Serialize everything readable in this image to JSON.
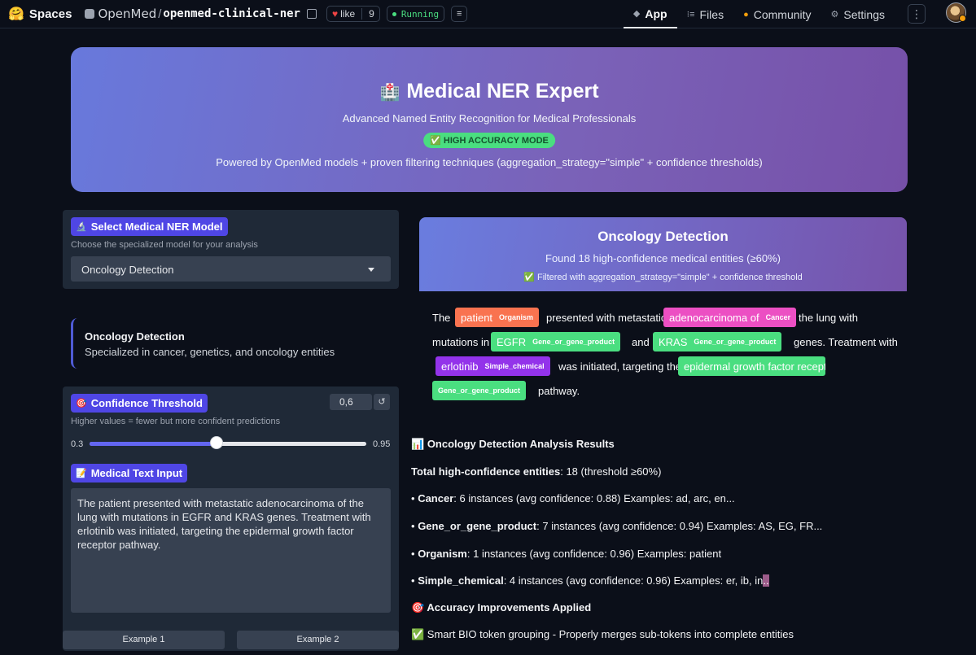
{
  "topbar": {
    "brand_emoji": "🤗",
    "brand_label": "Spaces",
    "owner": "OpenMed",
    "repo": "openmed-clinical-ner",
    "like_label": "like",
    "like_count": "9",
    "status": "Running",
    "nav": [
      {
        "label": "App",
        "icon": "cube-icon"
      },
      {
        "label": "Files",
        "icon": "files-icon"
      },
      {
        "label": "Community",
        "icon": "community-icon"
      },
      {
        "label": "Settings",
        "icon": "gear-icon"
      }
    ]
  },
  "hero": {
    "icon": "🏥",
    "title": "Medical NER Expert",
    "subtitle": "Advanced Named Entity Recognition for Medical Professionals",
    "badge": "✅ HIGH ACCURACY MODE",
    "powered": "Powered by OpenMed models + proven filtering techniques (aggregation_strategy=\"simple\" + confidence thresholds)"
  },
  "model_panel": {
    "chip_icon": "🔬",
    "chip_label": "Select Medical NER Model",
    "hint": "Choose the specialized model for your analysis",
    "selected": "Oncology Detection"
  },
  "info_card": {
    "title": "Oncology Detection",
    "description": "Specialized in cancer, genetics, and oncology entities"
  },
  "threshold_panel": {
    "chip_icon": "🎯",
    "chip_label": "Confidence Threshold",
    "hint": "Higher values = fewer but more confident predictions",
    "value": "0,6",
    "reset_icon": "↺",
    "min": "0.3",
    "max": "0.95",
    "fraction": 0.46
  },
  "text_input": {
    "chip_icon": "📝",
    "chip_label": "Medical Text Input",
    "value": "The patient presented with metastatic adenocarcinoma of the lung with mutations in EGFR and KRAS genes. Treatment with erlotinib was initiated, targeting the epidermal growth factor receptor pathway."
  },
  "examples": [
    "Example 1",
    "Example 2"
  ],
  "output_header": {
    "title": "Oncology Detection",
    "count_text": "Found 18 high-confidence medical entities (≥60%)",
    "filter_text": "✅ Filtered with aggregation_strategy=\"simple\" + confidence threshold"
  },
  "highlighted": {
    "t1": "The",
    "e1": {
      "text": "patient",
      "label": "Organism"
    },
    "t2": "presented with metastatic",
    "e2": {
      "text": "adenocarcinoma of",
      "label": "Cancer"
    },
    "t3": "the lung with",
    "t4": "mutations in",
    "e3": {
      "text": "EGFR",
      "label": "Gene_or_gene_product"
    },
    "t5": "and",
    "e4": {
      "text": "KRAS",
      "label": "Gene_or_gene_product"
    },
    "t6": "genes. Treatment with",
    "e5": {
      "text": "erlotinib",
      "label": "Simple_chemical"
    },
    "t7": "was initiated, targeting the",
    "e6": {
      "text": "epidermal growth factor receptor",
      "label": "Gene_or_gene_product"
    },
    "t8": "pathway."
  },
  "results": {
    "heading_icon": "📊",
    "heading": "Oncology Detection Analysis Results",
    "total_label": "Total high-confidence entities",
    "total_value": ": 18 (threshold ≥60%)",
    "items": [
      {
        "name": "Cancer",
        "detail": ": 6 instances (avg confidence: 0.88) Examples: ad, arc, en..."
      },
      {
        "name": "Gene_or_gene_product",
        "detail": ": 7 instances (avg confidence: 0.94) Examples: AS, EG, FR..."
      },
      {
        "name": "Organism",
        "detail": ": 1 instances (avg confidence: 0.96) Examples: patient"
      },
      {
        "name": "Simple_chemical",
        "detail": ": 4 instances (avg confidence: 0.96) Examples: er, ib, in",
        "selected_tail": ".."
      }
    ],
    "bullet": "•",
    "improve_icon": "🎯",
    "improve_heading": "Accuracy Improvements Applied",
    "improve_line": "✅ Smart BIO token grouping - Properly merges sub-tokens into complete entities"
  },
  "colors": {
    "organism": "#f97350",
    "cancer": "#ec4fc3",
    "gene": "#4ade80",
    "chemical": "#9333ea",
    "accent": "#4f46e5"
  }
}
